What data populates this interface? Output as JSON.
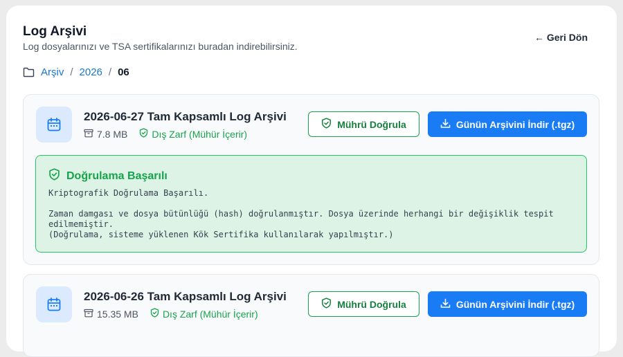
{
  "header": {
    "title": "Log Arşivi",
    "subtitle": "Log dosyalarınızı ve TSA sertifikalarınızı buradan indirebilirsiniz.",
    "back_label": "← Geri Dön"
  },
  "breadcrumb": {
    "root": "Arşiv",
    "year": "2026",
    "separator": "/",
    "current": "06"
  },
  "archives": [
    {
      "title": "2026-06-27 Tam Kapsamlı Log Arşivi",
      "size": "7.8 MB",
      "seal_status": "Dış Zarf (Mühür İçerir)",
      "verify_label": "Mührü Doğrula",
      "download_label": "Günün Arşivini İndir (.tgz)"
    },
    {
      "title": "2026-06-26 Tam Kapsamlı Log Arşivi",
      "size": "15.35 MB",
      "seal_status": "Dış Zarf (Mühür İçerir)",
      "verify_label": "Mührü Doğrula",
      "download_label": "Günün Arşivini İndir (.tgz)"
    }
  ],
  "verification": {
    "title": "Doğrulama Başarılı",
    "body": "Kriptografik Doğrulama Başarılı.\n\nZaman damgası ve dosya bütünlüğü (hash) doğrulanmıştır. Dosya üzerinde herhangi bir değişiklik tespit edilmemiştir.\n(Doğrulama, sisteme yüklenen Kök Sertifika kullanılarak yapılmıştır.)"
  },
  "colors": {
    "accent_blue": "#1a7cf5",
    "success_green": "#16a34a",
    "success_bg": "#dcf3e5"
  },
  "icons": {
    "folder": "folder-icon",
    "calendar": "calendar-icon",
    "archive_box": "archive-box-icon",
    "shield_check": "shield-check-icon",
    "download": "download-icon"
  }
}
